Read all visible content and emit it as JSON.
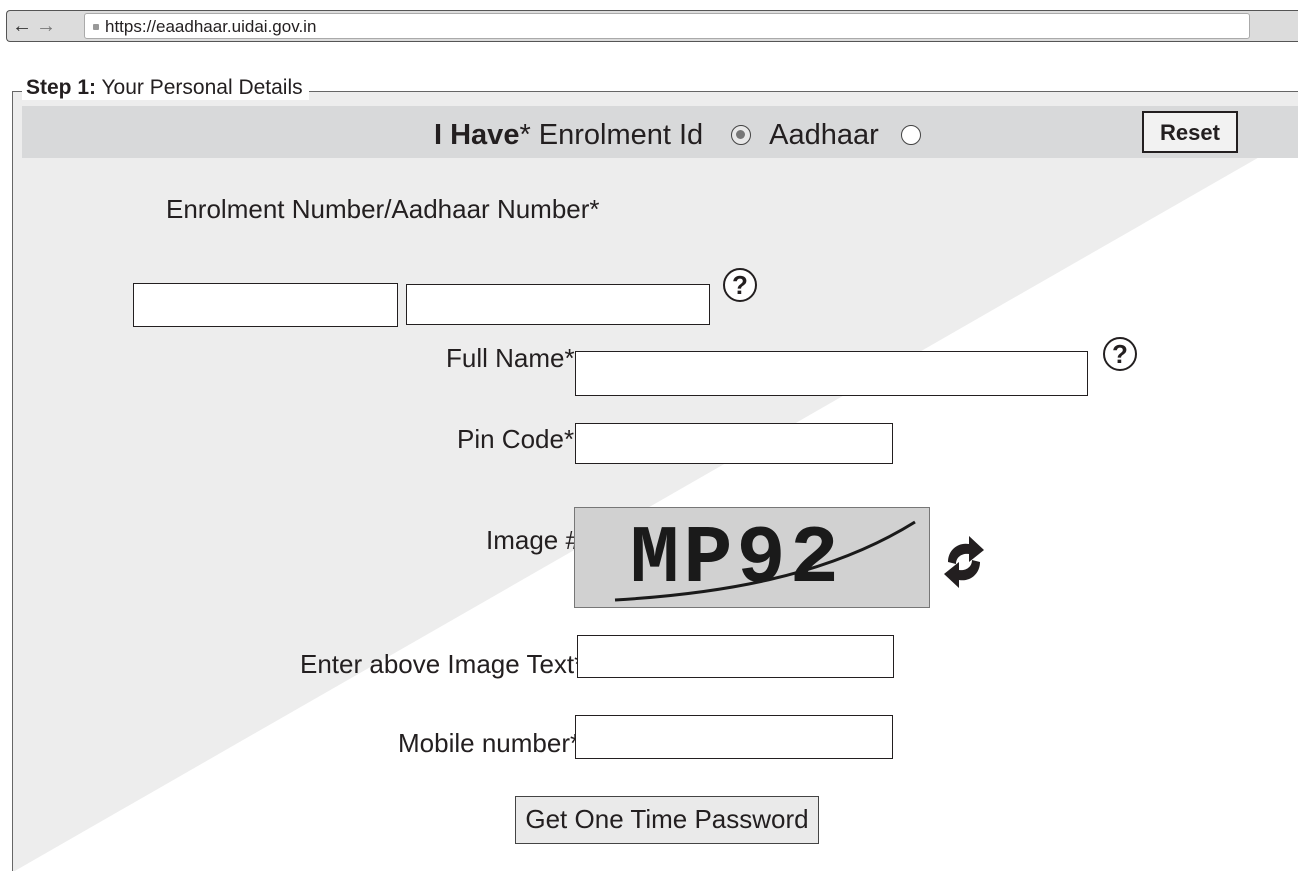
{
  "browser": {
    "back_glyph": "←",
    "forward_glyph": "→",
    "url": "https://eaadhaar.uidai.gov.in"
  },
  "form": {
    "legend_bold": "Step 1:",
    "legend_rest": " Your Personal Details",
    "ihave": {
      "label_bold": "I Have",
      "label_star": "*",
      "option_enrolment": "Enrolment Id",
      "option_aadhaar": "Aadhaar",
      "selected": "enrolment"
    },
    "reset_label": "Reset",
    "enrolment_label": "Enrolment Number/Aadhaar Number*",
    "enrolment_part1": "",
    "enrolment_part2": "",
    "help_glyph": "?",
    "full_name_label": "Full Name*",
    "full_name_value": "",
    "pin_label": "Pin Code*",
    "pin_value": "",
    "image_label": "Image #",
    "captcha_text": "MP92",
    "captcha_input_label": "Enter above Image Text*",
    "captcha_input_value": "",
    "mobile_label": "Mobile number*",
    "mobile_value": "",
    "otp_button": "Get One Time Password"
  },
  "icons": {
    "help": "question-mark-icon",
    "refresh": "refresh-icon",
    "lock": "lock-icon"
  },
  "colors": {
    "header_bar": "#d8d9da",
    "background_triangle": "#ededed",
    "captcha_bg": "#d1d1d1"
  }
}
